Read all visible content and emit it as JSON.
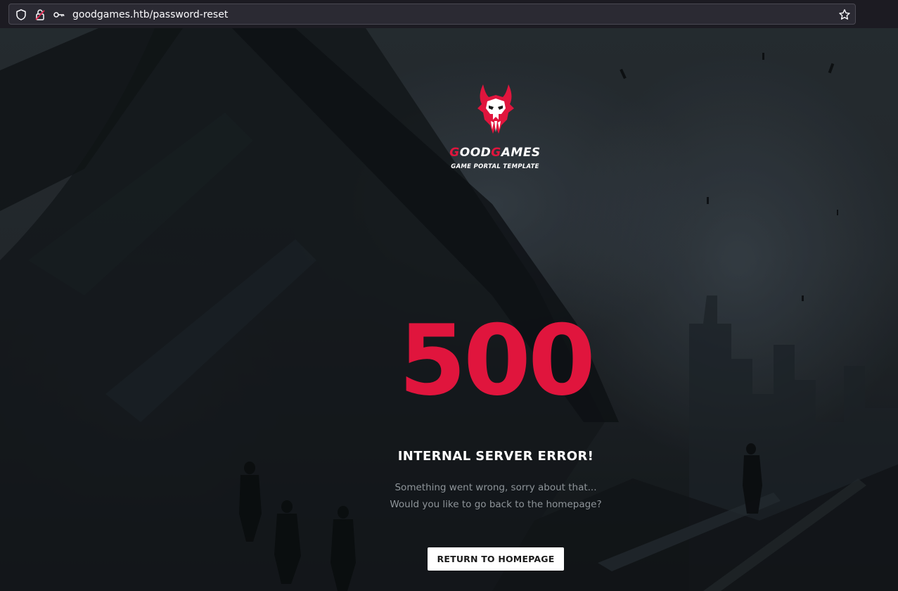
{
  "browser": {
    "url": "goodgames.htb/password-reset",
    "icons": [
      "shield-icon",
      "lock-warning-icon",
      "key-icon",
      "bookmark-star-icon"
    ]
  },
  "logo": {
    "brand_prefix": "G",
    "brand_mid": "OOD",
    "brand_g2": "G",
    "brand_suffix": "AMES",
    "tagline": "GAME PORTAL TEMPLATE",
    "icon": "demon-skull-icon"
  },
  "error": {
    "code": "500",
    "title": "INTERNAL SERVER ERROR!",
    "line1": "Something went wrong, sorry about that...",
    "line2": "Would you like to go back to the homepage?"
  },
  "actions": {
    "home_label": "RETURN TO HOMEPAGE"
  },
  "colors": {
    "accent": "#e0153d",
    "text": "#ffffff",
    "muted": "#8e9499",
    "browser_bg": "#1c1b22",
    "urlbar_bg": "#2b2a33"
  }
}
